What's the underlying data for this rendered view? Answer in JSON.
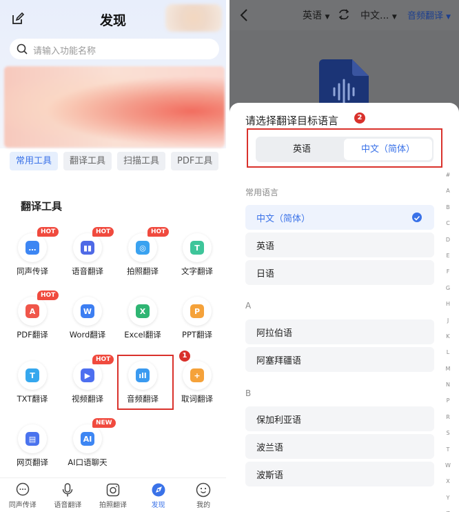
{
  "left": {
    "title": "发现",
    "search_placeholder": "请输入功能名称",
    "chips": [
      "常用工具",
      "翻译工具",
      "扫描工具",
      "PDF工具"
    ],
    "section_title": "翻译工具",
    "tools": [
      {
        "label": "同声传译",
        "icon": "simultaneous-interpretation-icon",
        "badge": "HOT",
        "color": "#3d86f3",
        "glyph": "…"
      },
      {
        "label": "语音翻译",
        "icon": "voice-translate-icon",
        "badge": "HOT",
        "color": "#4e69e6",
        "glyph": "▮▮"
      },
      {
        "label": "拍照翻译",
        "icon": "photo-translate-icon",
        "badge": "HOT",
        "color": "#3aa2f0",
        "glyph": "◎"
      },
      {
        "label": "文字翻译",
        "icon": "text-translate-icon",
        "badge": "",
        "color": "#3ec59a",
        "glyph": "T"
      },
      {
        "label": "PDF翻译",
        "icon": "pdf-translate-icon",
        "badge": "HOT",
        "color": "#f0564a",
        "glyph": "A"
      },
      {
        "label": "Word翻译",
        "icon": "word-translate-icon",
        "badge": "",
        "color": "#3c7ef2",
        "glyph": "W"
      },
      {
        "label": "Excel翻译",
        "icon": "excel-translate-icon",
        "badge": "",
        "color": "#2fb573",
        "glyph": "X"
      },
      {
        "label": "PPT翻译",
        "icon": "ppt-translate-icon",
        "badge": "",
        "color": "#f5a23a",
        "glyph": "P"
      },
      {
        "label": "TXT翻译",
        "icon": "txt-translate-icon",
        "badge": "",
        "color": "#35a7ee",
        "glyph": "T"
      },
      {
        "label": "视频翻译",
        "icon": "video-translate-icon",
        "badge": "HOT",
        "color": "#4d6ff0",
        "glyph": "▶"
      },
      {
        "label": "音频翻译",
        "icon": "audio-translate-icon",
        "badge": "",
        "color": "#3a9af0",
        "glyph": "ıll"
      },
      {
        "label": "取词翻译",
        "icon": "word-capture-translate-icon",
        "badge": "",
        "color": "#f5a23a",
        "glyph": "+"
      },
      {
        "label": "网页翻译",
        "icon": "webpage-translate-icon",
        "badge": "",
        "color": "#4a73ee",
        "glyph": "▤"
      },
      {
        "label": "AI口语聊天",
        "icon": "ai-oral-chat-icon",
        "badge": "NEW",
        "color": "#3d86f3",
        "glyph": "AI"
      }
    ],
    "step1": "1",
    "bottom_nav": [
      {
        "label": "同声传译",
        "icon": "chat-bubble-icon",
        "active": false
      },
      {
        "label": "语音翻译",
        "icon": "microphone-icon",
        "active": false
      },
      {
        "label": "拍照翻译",
        "icon": "camera-icon",
        "active": false
      },
      {
        "label": "发现",
        "icon": "discover-icon",
        "active": true
      },
      {
        "label": "我的",
        "icon": "profile-icon",
        "active": false
      }
    ]
  },
  "right": {
    "source_lang": "英语",
    "target_lang": "中文...",
    "mode": "音频翻译",
    "sheet_title": "请选择翻译目标语言",
    "step2": "2",
    "segment": {
      "left": "英语",
      "right": "中文（简体）"
    },
    "groups": [
      {
        "label": "常用语言",
        "items": [
          "中文（简体）",
          "英语",
          "日语"
        ]
      },
      {
        "label": "A",
        "items": [
          "阿拉伯语",
          "阿塞拜疆语"
        ]
      },
      {
        "label": "B",
        "items": [
          "保加利亚语",
          "波兰语",
          "波斯语"
        ]
      }
    ],
    "selected": "中文（简体）",
    "index": [
      "#",
      "A",
      "B",
      "C",
      "D",
      "E",
      "F",
      "G",
      "H",
      "J",
      "K",
      "L",
      "M",
      "N",
      "P",
      "R",
      "S",
      "T",
      "W",
      "X",
      "Y",
      "Z"
    ]
  },
  "colors": {
    "accent": "#3a72e8",
    "highlight": "#d9312b",
    "badge": "#f04a3e"
  }
}
